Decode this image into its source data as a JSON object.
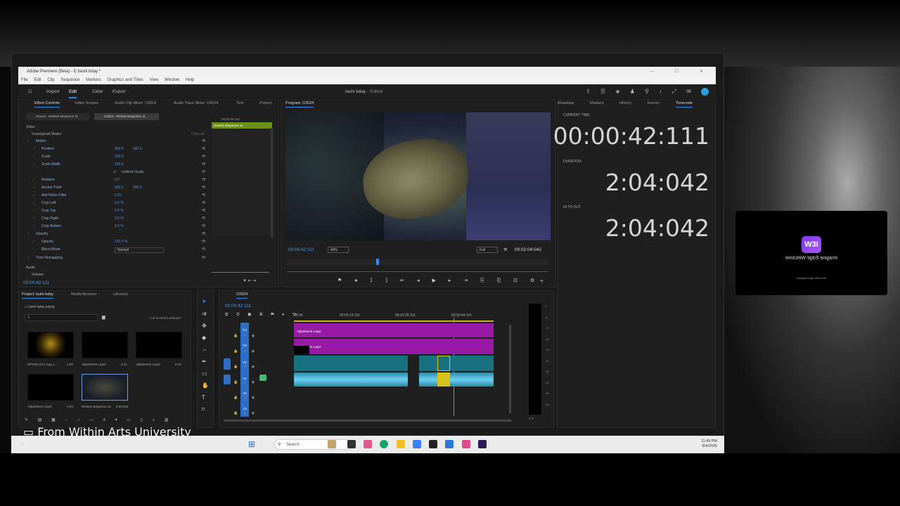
{
  "window": {
    "title": "Adobe Premiere (Beta) - E:\\lashi bday *",
    "menu": [
      "File",
      "Edit",
      "Clip",
      "Sequence",
      "Markers",
      "Graphics and Titles",
      "View",
      "Window",
      "Help"
    ]
  },
  "appbar": {
    "home_icon": "home-icon",
    "import": "Import",
    "edit": "Edit",
    "color": "Color",
    "export": "Export",
    "project_title": "lashi bday",
    "project_status": "- Edited"
  },
  "source_panel": {
    "tabs": [
      "Effect Controls",
      "Video Scopes",
      "Audio Clip Mixer: C0024",
      "Audio Track Mixer: C0024",
      "Text",
      "Project"
    ],
    "subtabs": [
      "Source - Nested Sequence 11",
      "C0024 - Nested Sequence 11"
    ],
    "mini_tc": "00:00:29:115",
    "clip_label": "Nested Sequence 11",
    "video_label": "Video",
    "unassigned": "Unassigned Masks",
    "clear_all": "Clear all",
    "rows": [
      {
        "label": "Motion",
        "v1": "",
        "v2": ""
      },
      {
        "label": "Position",
        "v1": "960.0",
        "v2": "540.0"
      },
      {
        "label": "Scale",
        "v1": "100.0",
        "v2": ""
      },
      {
        "label": "Scale Width",
        "v1": "100.0",
        "v2": ""
      },
      {
        "label": "Uniform Scale",
        "v1": "",
        "v2": ""
      },
      {
        "label": "Rotation",
        "v1": "0.0",
        "v2": ""
      },
      {
        "label": "Anchor Point",
        "v1": "960.0",
        "v2": "540.0"
      },
      {
        "label": "Anti-flicker Filter",
        "v1": "0.00",
        "v2": ""
      },
      {
        "label": "Crop Left",
        "v1": "0.0 %",
        "v2": ""
      },
      {
        "label": "Crop Top",
        "v1": "0.0 %",
        "v2": ""
      },
      {
        "label": "Crop Right",
        "v1": "0.0 %",
        "v2": ""
      },
      {
        "label": "Crop Bottom",
        "v1": "0.0 %",
        "v2": ""
      },
      {
        "label": "Opacity",
        "v1": "",
        "v2": ""
      },
      {
        "label": "Opacity",
        "v1": "100.0 %",
        "v2": ""
      },
      {
        "label": "Blend Mode",
        "v1": "Normal",
        "v2": ""
      },
      {
        "label": "Time Remapping",
        "v1": "",
        "v2": ""
      }
    ],
    "audio_label": "Audio",
    "volume_label": "Volume",
    "bottom_tc": "00:00:42:111"
  },
  "program": {
    "tab": "Program: C0024",
    "current_tc": "00:00:42:111",
    "zoom": "49%",
    "quality": "Full",
    "duration_tc": "00:02:04:042"
  },
  "timecode_panel": {
    "tabs": [
      "Metadata",
      "Markers",
      "History",
      "Events",
      "Timecode"
    ],
    "current_label": "CURRENT TIME",
    "current": "00:00:42:111",
    "duration_label": "DURATION",
    "duration": "2:04:042",
    "inout_label": "IN TO OUT",
    "inout": "2:04:042"
  },
  "project": {
    "tabs": [
      "Project: lashi bday",
      "Media Browser",
      "Libraries"
    ],
    "file": "lashi bday.prproj",
    "selected": "1 of 44 items selected",
    "items": [
      {
        "name": "SPOKE DAY Aug 4...",
        "dur": "4:29"
      },
      {
        "name": "Adjustment Layer",
        "dur": "4:23"
      },
      {
        "name": "Adjustment Layer",
        "dur": "4:23"
      },
      {
        "name": "Adjustment Layer",
        "dur": "4:23"
      },
      {
        "name": "Nested Sequence 11",
        "dur": "2:04:042"
      }
    ]
  },
  "timeline": {
    "tab": "C0024",
    "tc": "00:00:42:111",
    "ruler": [
      "00:00",
      "00:00:14:116",
      "00:00:29:116",
      "00:00:44:114"
    ],
    "adj1": "Adjustment Layer",
    "adj2": "Adjustment Layer",
    "tracks": [
      "V3",
      "V2",
      "V1",
      "A1",
      "A2",
      "A3"
    ],
    "meter_ticks": [
      "0",
      "-6",
      "-12",
      "-18",
      "-24",
      "-30",
      "-36",
      "-42",
      "-48",
      "-54"
    ],
    "meter_bottom": "S S"
  },
  "caption": "From Within Arts University",
  "taskbar": {
    "search": "Search",
    "time": "11:49 PM",
    "date": "8/4/2026"
  },
  "edge_popup": {
    "title": "Imagine Edge Welcome",
    "sub": "Imagine Edge Welcome",
    "logo": "W3I"
  }
}
